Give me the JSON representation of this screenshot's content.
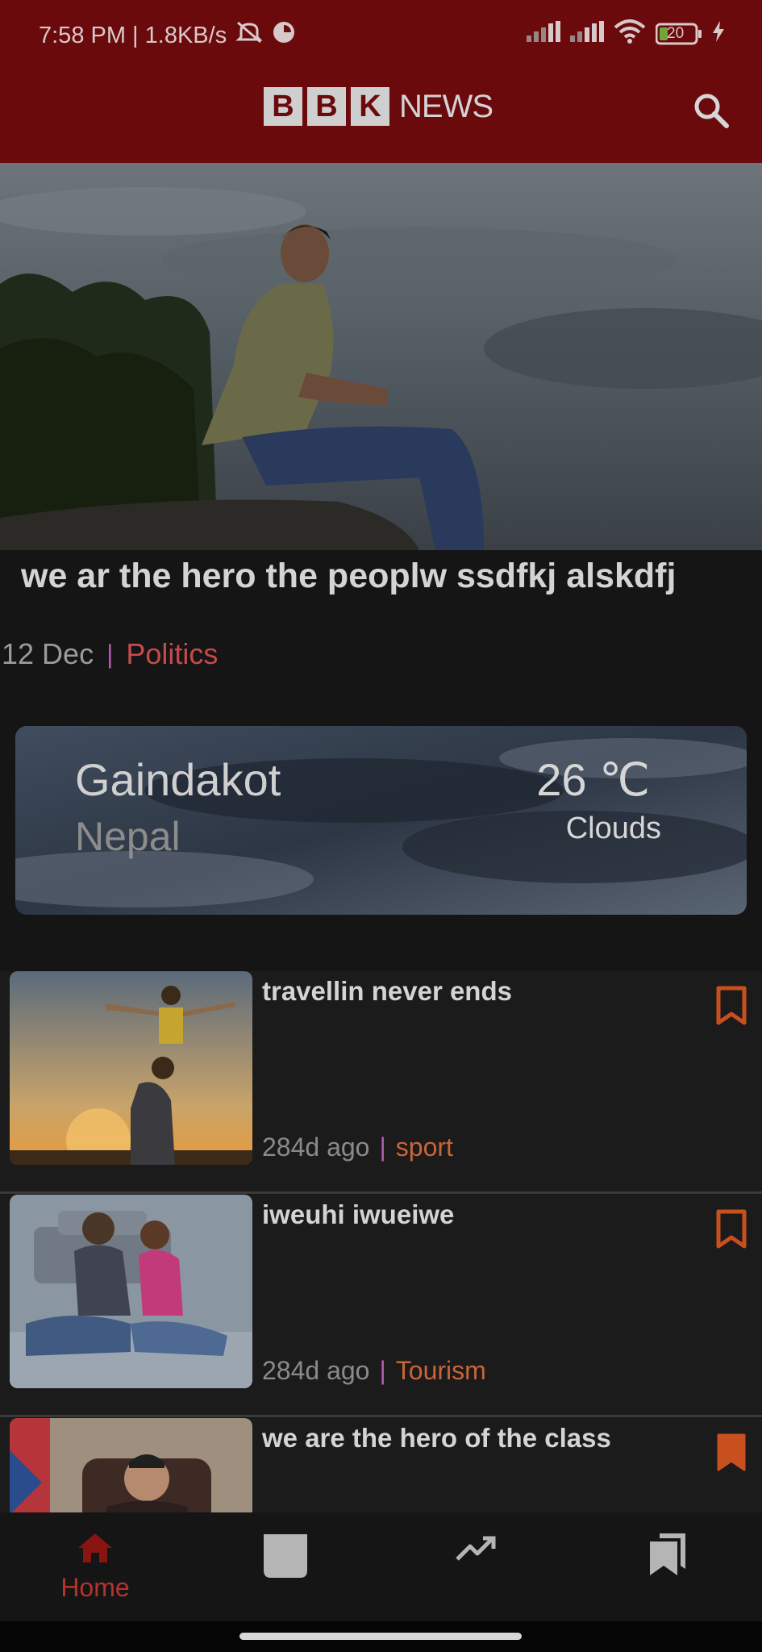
{
  "status_bar": {
    "time_speed": "7:58 PM | 1.8KB/s",
    "battery": "20"
  },
  "app_bar": {
    "logo_letters": [
      "B",
      "B",
      "K"
    ],
    "logo_word": "NEWS"
  },
  "hero": {
    "title": "we ar the hero the peoplw ssdfkj alskdfj",
    "date": "12 Dec",
    "separator": "|",
    "category": "Politics"
  },
  "weather": {
    "city": "Gaindakot",
    "country": "Nepal",
    "temperature": "26 ℃",
    "condition": "Clouds"
  },
  "news_list": [
    {
      "title": "travellin never ends",
      "ago": "284d ago",
      "separator": "|",
      "category": "sport",
      "bookmarked": false
    },
    {
      "title": "iweuhi iwueiwe",
      "ago": "284d ago",
      "separator": "|",
      "category": "Tourism",
      "bookmarked": false
    },
    {
      "title": "we are the hero of the class",
      "ago": "",
      "separator": "",
      "category": "",
      "bookmarked": true
    }
  ],
  "bottom_nav": {
    "home_label": "Home"
  },
  "colors": {
    "brand": "#6b0a0d",
    "accent": "#c64a4a",
    "bookmark": "#c8501e"
  },
  "icons": [
    "search-icon",
    "bookmark-outline-icon",
    "bookmark-filled-icon",
    "home-icon",
    "news-icon",
    "trending-icon",
    "bookmarks-icon",
    "wifi-icon",
    "signal-icon",
    "battery-icon",
    "mute-icon"
  ]
}
